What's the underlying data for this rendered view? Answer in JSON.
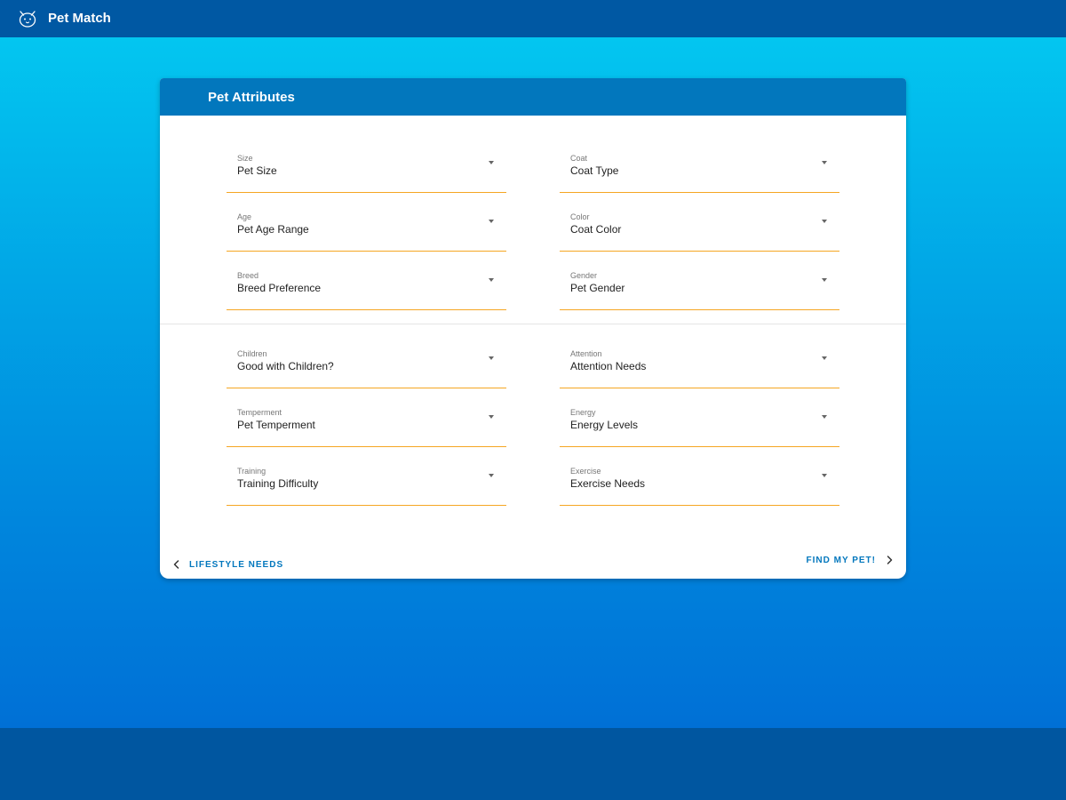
{
  "app": {
    "title": "Pet Match",
    "logo_icon": "cat-face-icon"
  },
  "card": {
    "title": "Pet Attributes"
  },
  "sections": [
    {
      "fields": [
        {
          "label": "Size",
          "value": "Pet Size"
        },
        {
          "label": "Coat",
          "value": "Coat Type"
        },
        {
          "label": "Age",
          "value": "Pet Age Range"
        },
        {
          "label": "Color",
          "value": "Coat Color"
        },
        {
          "label": "Breed",
          "value": "Breed Preference"
        },
        {
          "label": "Gender",
          "value": "Pet Gender"
        }
      ]
    },
    {
      "fields": [
        {
          "label": "Children",
          "value": "Good with Children?"
        },
        {
          "label": "Attention",
          "value": "Attention Needs"
        },
        {
          "label": "Temperment",
          "value": "Pet Temperment"
        },
        {
          "label": "Energy",
          "value": "Energy Levels"
        },
        {
          "label": "Training",
          "value": "Training Difficulty"
        },
        {
          "label": "Exercise",
          "value": "Exercise Needs"
        }
      ]
    }
  ],
  "nav": {
    "back_label": "LIFESTYLE NEEDS",
    "next_label": "FIND MY PET!"
  },
  "colors": {
    "topbar": "#0058a3",
    "card_header": "#0277bd",
    "field_underline": "#f5a623",
    "nav_text": "#0277bd"
  }
}
